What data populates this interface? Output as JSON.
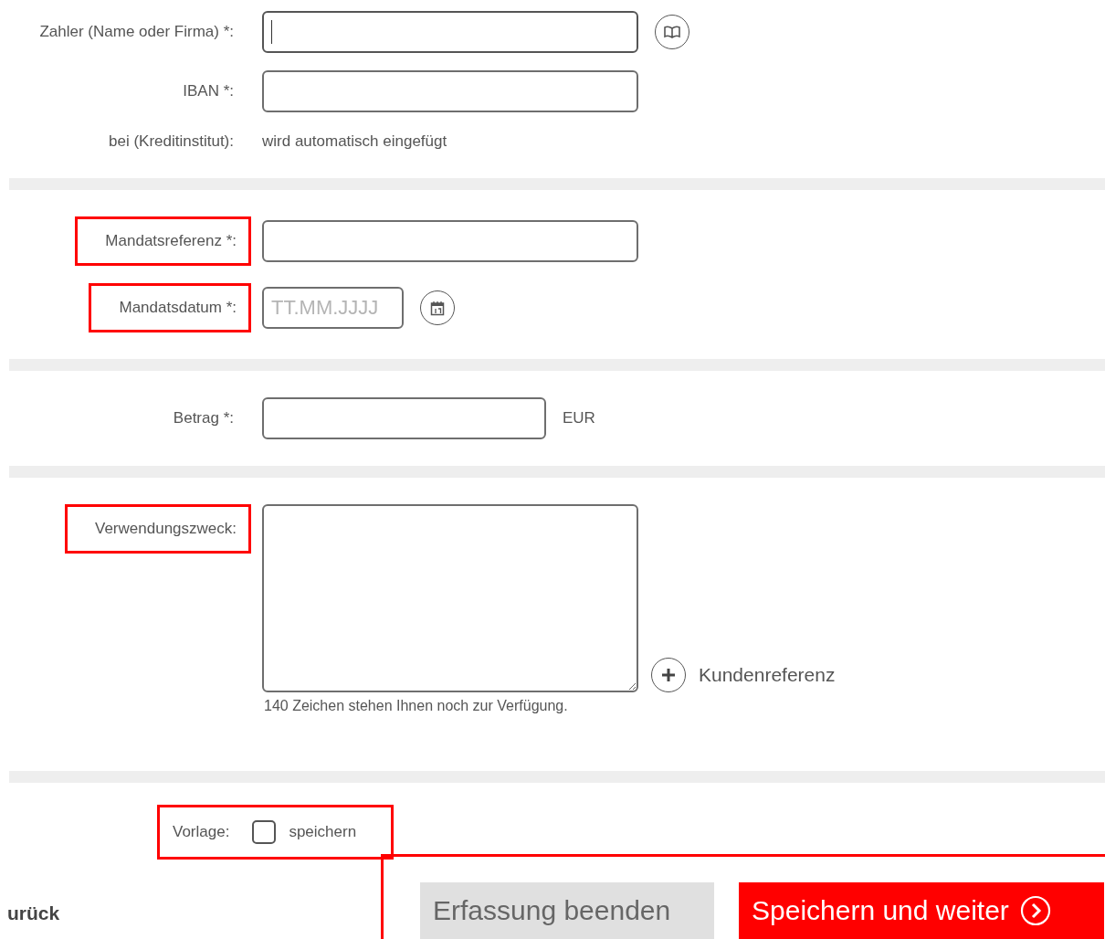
{
  "sections": [
    {
      "rows": [
        {
          "kind": "lookup_input",
          "label": "Zahler (Name oder Firma) *:",
          "highlighted": false,
          "focused": true
        },
        {
          "kind": "input",
          "label": "IBAN *:",
          "highlighted": false,
          "focused": false
        },
        {
          "kind": "text",
          "label": "bei (Kreditinstitut):",
          "highlighted": false,
          "value": "wird automatisch eingefügt"
        }
      ]
    },
    {
      "rows": [
        {
          "kind": "input",
          "label": "Mandatsreferenz *:",
          "highlighted": true,
          "focused": false
        },
        {
          "kind": "date",
          "label": "Mandatsdatum *:",
          "highlighted": true,
          "focused": false,
          "placeholder": "TT.MM.JJJJ"
        }
      ]
    },
    {
      "rows": [
        {
          "kind": "amount",
          "label": "Betrag *:",
          "highlighted": false,
          "focused": false,
          "unit": "EUR"
        }
      ]
    },
    {
      "rows": [
        {
          "kind": "textarea",
          "label": "Verwendungszweck:",
          "highlighted": true,
          "hint": "140 Zeichen stehen Ihnen noch zur Verfügung.",
          "link": "Kundenreferenz"
        }
      ]
    }
  ],
  "template": {
    "label": "Vorlage:",
    "checkbox_label": "speichern",
    "checked": false,
    "highlighted": true
  },
  "back_link": "urück",
  "buttons": [
    {
      "label": "Erfassung beenden",
      "kind": "secondary"
    },
    {
      "label": "Speichern und weiter",
      "kind": "primary"
    }
  ],
  "buttons_highlighted": true
}
